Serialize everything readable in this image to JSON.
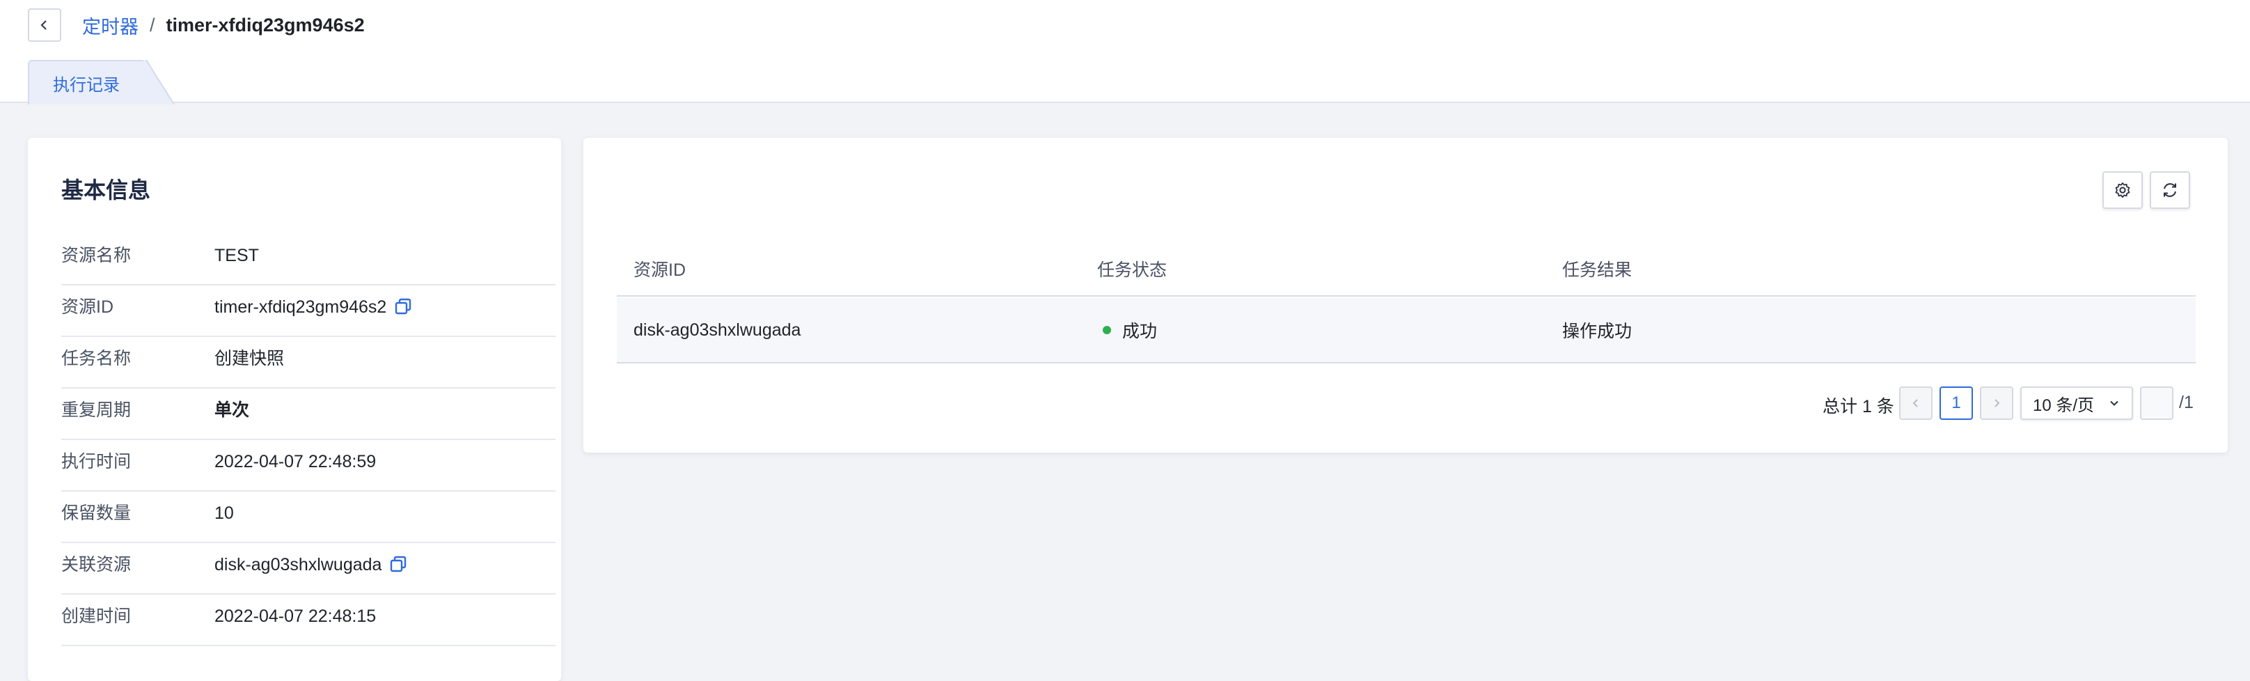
{
  "breadcrumb": {
    "parent": "定时器",
    "separator": "/",
    "current": "timer-xfdiq23gm946s2"
  },
  "tabs": [
    {
      "label": "执行记录",
      "active": true
    }
  ],
  "basic_info": {
    "title": "基本信息",
    "rows": [
      {
        "label": "资源名称",
        "value": "TEST"
      },
      {
        "label": "资源ID",
        "value": "timer-xfdiq23gm946s2",
        "copyable": true
      },
      {
        "label": "任务名称",
        "value": "创建快照"
      },
      {
        "label": "重复周期",
        "value": "单次"
      },
      {
        "label": "执行时间",
        "value": "2022-04-07 22:48:59"
      },
      {
        "label": "保留数量",
        "value": "10"
      },
      {
        "label": "关联资源",
        "value": "disk-ag03shxlwugada",
        "copyable": true
      },
      {
        "label": "创建时间",
        "value": "2022-04-07 22:48:15"
      }
    ]
  },
  "table": {
    "toolbar": {
      "settings_icon": "gear-icon",
      "refresh_icon": "refresh-icon"
    },
    "columns": [
      "资源ID",
      "任务状态",
      "任务结果"
    ],
    "rows": [
      {
        "resource_id": "disk-ag03shxlwugada",
        "status": "成功",
        "result": "操作成功"
      }
    ]
  },
  "pagination": {
    "total_text": "总计 1 条",
    "current_page": "1",
    "page_size": "10 条/页",
    "page_input": "",
    "total_pages": "/1"
  },
  "colors": {
    "accent": "#2f6bdd",
    "success": "#2eb04f",
    "background": "#f2f3f7"
  }
}
